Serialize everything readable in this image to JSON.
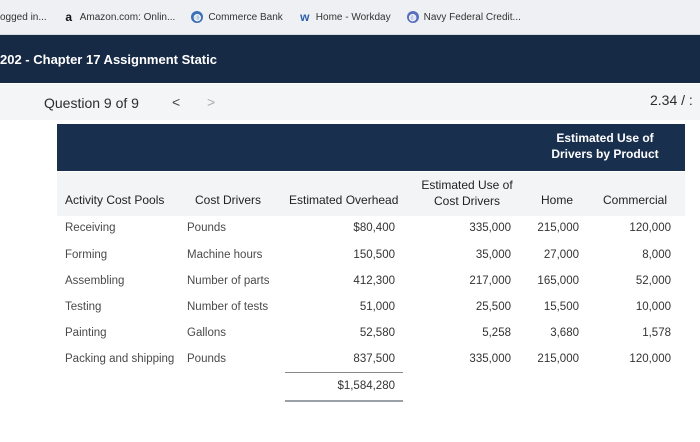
{
  "bookmarks": [
    {
      "label": "ogged in...",
      "icon": ""
    },
    {
      "label": "Amazon.com: Onlin...",
      "icon": "amazon-icon"
    },
    {
      "label": "Commerce Bank",
      "icon": "globe-icon"
    },
    {
      "label": "Home - Workday",
      "icon": "workday-icon"
    },
    {
      "label": "Navy Federal Credit...",
      "icon": "globe-icon"
    }
  ],
  "course": {
    "title": "202 - Chapter 17 Assignment Static"
  },
  "question": {
    "label": "Question 9 of 9",
    "prev": "<",
    "next": ">",
    "score": "2.34 / :"
  },
  "table": {
    "group_header": "Estimated Use of Drivers by Product",
    "columns": {
      "pool": "Activity Cost Pools",
      "driver": "Cost Drivers",
      "overhead": "Estimated Overhead",
      "est_use": "Estimated Use of Cost Drivers",
      "home": "Home",
      "commercial": "Commercial"
    },
    "rows": [
      {
        "pool": "Receiving",
        "driver": "Pounds",
        "overhead": "$80,400",
        "est_use": "335,000",
        "home": "215,000",
        "commercial": "120,000"
      },
      {
        "pool": "Forming",
        "driver": "Machine hours",
        "overhead": "150,500",
        "est_use": "35,000",
        "home": "27,000",
        "commercial": "8,000"
      },
      {
        "pool": "Assembling",
        "driver": "Number of parts",
        "overhead": "412,300",
        "est_use": "217,000",
        "home": "165,000",
        "commercial": "52,000"
      },
      {
        "pool": "Testing",
        "driver": "Number of tests",
        "overhead": "51,000",
        "est_use": "25,500",
        "home": "15,500",
        "commercial": "10,000"
      },
      {
        "pool": "Painting",
        "driver": "Gallons",
        "overhead": "52,580",
        "est_use": "5,258",
        "home": "3,680",
        "commercial": "1,578"
      },
      {
        "pool": "Packing and shipping",
        "driver": "Pounds",
        "overhead": "837,500",
        "est_use": "335,000",
        "home": "215,000",
        "commercial": "120,000"
      }
    ],
    "total_overhead": "$1,584,280"
  }
}
